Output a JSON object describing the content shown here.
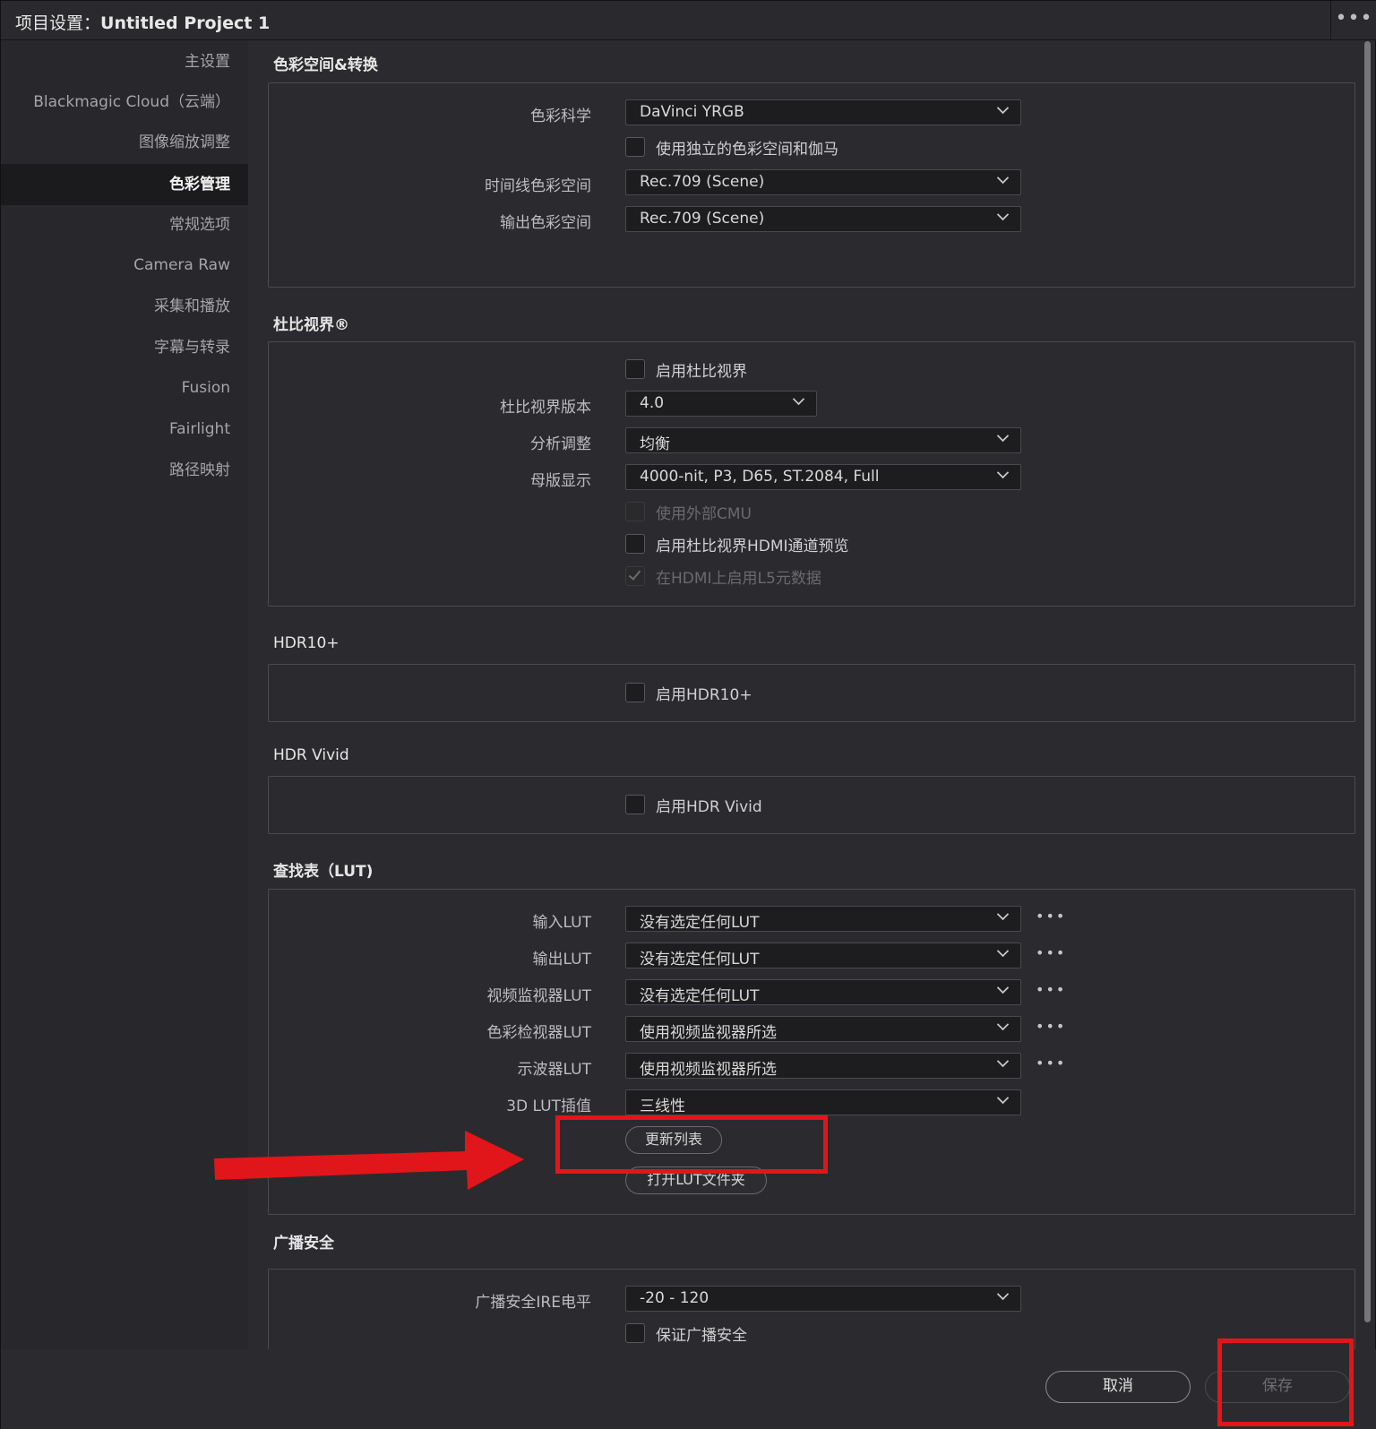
{
  "titlebar": {
    "prefix": "项目设置：",
    "project": "Untitled Project 1",
    "more": "•••"
  },
  "sidebar": {
    "items": [
      {
        "label": "主设置"
      },
      {
        "label": "Blackmagic Cloud（云端）"
      },
      {
        "label": "图像缩放调整"
      },
      {
        "label": "色彩管理",
        "active": true
      },
      {
        "label": "常规选项"
      },
      {
        "label": "Camera Raw"
      },
      {
        "label": "采集和播放"
      },
      {
        "label": "字幕与转录"
      },
      {
        "label": "Fusion"
      },
      {
        "label": "Fairlight"
      },
      {
        "label": "路径映射"
      }
    ]
  },
  "color_space": {
    "title": "色彩空间&转换",
    "color_science_label": "色彩科学",
    "color_science_value": "DaVinci YRGB",
    "separate_gamma_label": "使用独立的色彩空间和伽马",
    "timeline_space_label": "时间线色彩空间",
    "timeline_space_value": "Rec.709 (Scene)",
    "output_space_label": "输出色彩空间",
    "output_space_value": "Rec.709 (Scene)"
  },
  "dolby": {
    "title": "杜比视界®",
    "enable_label": "启用杜比视界",
    "version_label": "杜比视界版本",
    "version_value": "4.0",
    "analysis_label": "分析调整",
    "analysis_value": "均衡",
    "mastering_label": "母版显示",
    "mastering_value": "4000-nit, P3, D65, ST.2084, Full",
    "external_cmu_label": "使用外部CMU",
    "hdmi_preview_label": "启用杜比视界HDMI通道预览",
    "l5_label": "在HDMI上启用L5元数据"
  },
  "hdr10": {
    "title": "HDR10+",
    "enable_label": "启用HDR10+"
  },
  "hdr_vivid": {
    "title": "HDR Vivid",
    "enable_label": "启用HDR Vivid"
  },
  "lut": {
    "title": "查找表（LUT)",
    "rows": [
      {
        "label": "输入LUT",
        "value": "没有选定任何LUT"
      },
      {
        "label": "输出LUT",
        "value": "没有选定任何LUT"
      },
      {
        "label": "视频监视器LUT",
        "value": "没有选定任何LUT"
      },
      {
        "label": "色彩检视器LUT",
        "value": "使用视频监视器所选"
      },
      {
        "label": "示波器LUT",
        "value": "使用视频监视器所选"
      }
    ],
    "interp_label": "3D LUT插值",
    "interp_value": "三线性",
    "more": "•••",
    "update_button": "更新列表",
    "open_folder_button": "打开LUT文件夹"
  },
  "broadcast": {
    "title": "广播安全",
    "ire_label": "广播安全IRE电平",
    "ire_value": "-20 - 120",
    "ensure_label": "保证广播安全"
  },
  "footer": {
    "cancel": "取消",
    "save": "保存"
  },
  "colors": {
    "annotation": "#e0161a",
    "background": "#2b2b2f",
    "active_sidebar": "#1b1b1d"
  }
}
